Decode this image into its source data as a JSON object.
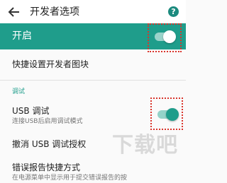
{
  "toolbar": {
    "title": "开发者选项",
    "back_icon": "arrow-back-icon",
    "help_icon": "help-icon",
    "help_glyph": "?"
  },
  "master_switch": {
    "label": "开启",
    "state": "on"
  },
  "quick_settings": {
    "label": "快捷设置开发者图块"
  },
  "section_debug": {
    "header": "调试"
  },
  "usb_debugging": {
    "title": "USB 调试",
    "summary": "连接USB后启用调试模式",
    "state": "on"
  },
  "revoke_usb": {
    "label": "撤消 USB 调试授权"
  },
  "bug_report": {
    "title": "错误报告快捷方式",
    "summary": "在电源菜单中显示用于提交错误报告的按"
  },
  "colors": {
    "accent": "#1f9d8b",
    "highlight_box": "#d9342b"
  }
}
